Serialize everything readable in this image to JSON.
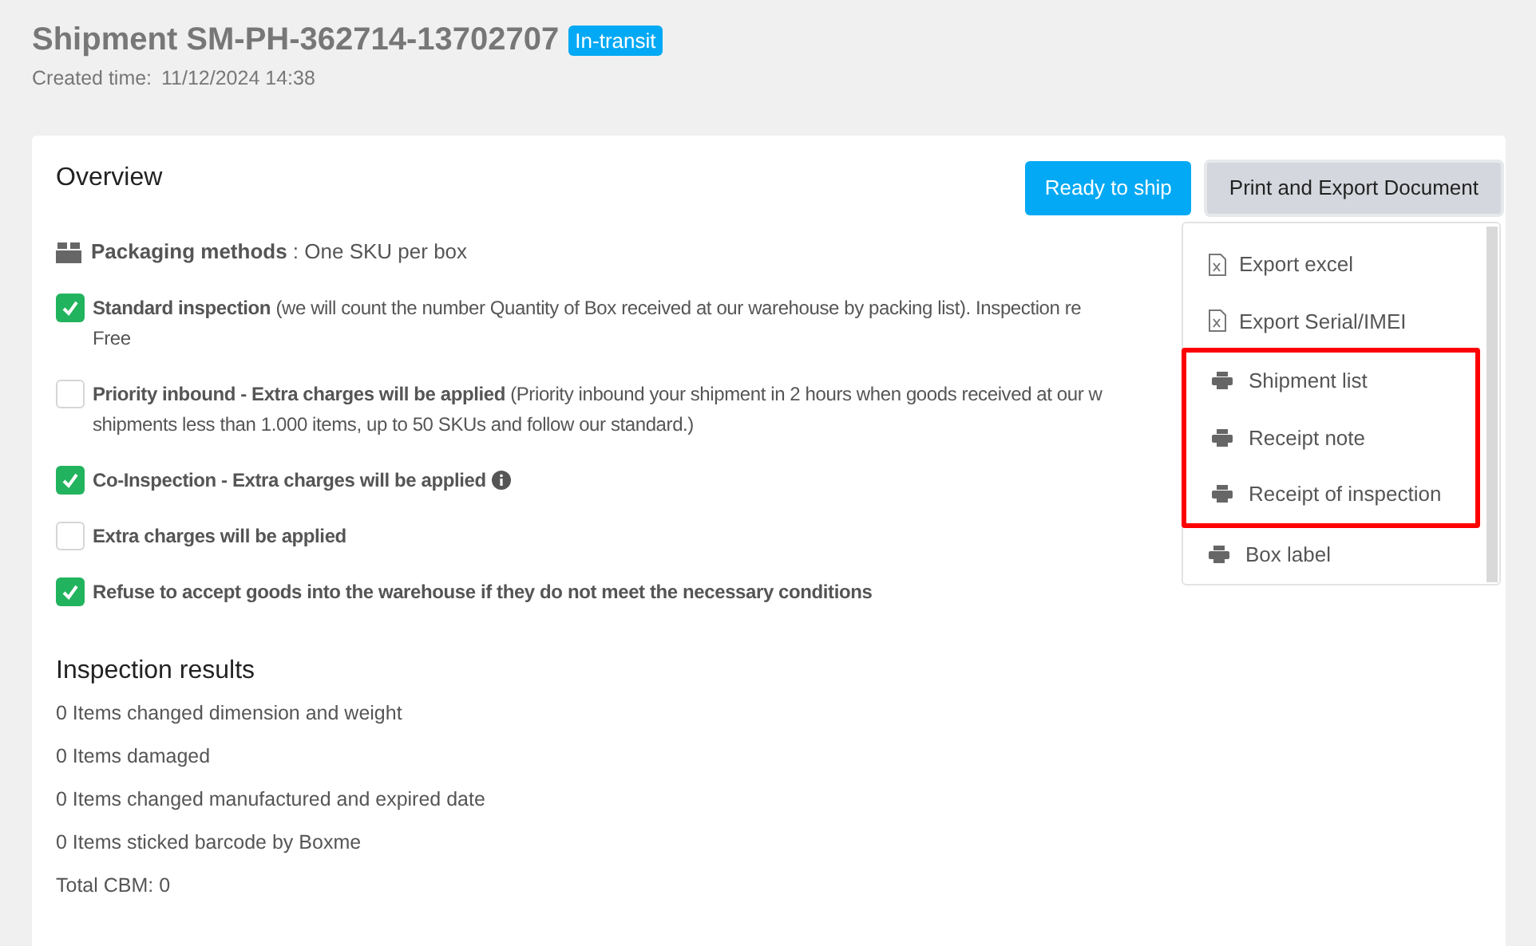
{
  "header": {
    "title": "Shipment SM-PH-362714-13702707",
    "status_badge": "In-transit",
    "created_label": "Created time:",
    "created_value": "11/12/2024 14:38"
  },
  "overview": {
    "title": "Overview",
    "packaging": {
      "label": "Packaging methods",
      "value": " : One SKU per box"
    },
    "options": [
      {
        "checked": true,
        "label": "Standard inspection",
        "detail": " (we will count the number Quantity of Box received at our warehouse by packing list). Inspection re",
        "detail_line_2": "Free",
        "info": false
      },
      {
        "checked": false,
        "label": "Priority inbound - Extra charges will be applied",
        "detail": " (Priority inbound your shipment in 2 hours when goods received at our w",
        "detail_line_2": "shipments less than 1.000 items, up to 50 SKUs and follow our standard.)",
        "info": false
      },
      {
        "checked": true,
        "label": "Co-Inspection - Extra charges will be applied",
        "info": true
      },
      {
        "checked": false,
        "label": "Extra charges will be applied",
        "info": false
      },
      {
        "checked": true,
        "label": "Refuse to accept goods into the warehouse if they do not meet the necessary conditions",
        "info": false
      }
    ]
  },
  "buttons": {
    "ready": "Ready to ship",
    "print": "Print and Export Document"
  },
  "menu": {
    "items": [
      {
        "kind": "excel",
        "label": "Export excel",
        "highlighted": false
      },
      {
        "kind": "excel",
        "label": "Export Serial/IMEI",
        "highlighted": false
      },
      {
        "kind": "print",
        "label": "Shipment list",
        "highlighted": true
      },
      {
        "kind": "print",
        "label": "Receipt note",
        "highlighted": true
      },
      {
        "kind": "print",
        "label": "Receipt of inspection",
        "highlighted": true
      },
      {
        "kind": "print",
        "label": "Box label",
        "highlighted": false
      }
    ]
  },
  "inspection_results": {
    "title": "Inspection results",
    "lines": [
      "0 Items changed dimension and weight",
      "0 Items damaged",
      "0 Items changed manufactured and expired date",
      "0 Items sticked barcode by Boxme",
      "Total CBM: 0"
    ]
  }
}
